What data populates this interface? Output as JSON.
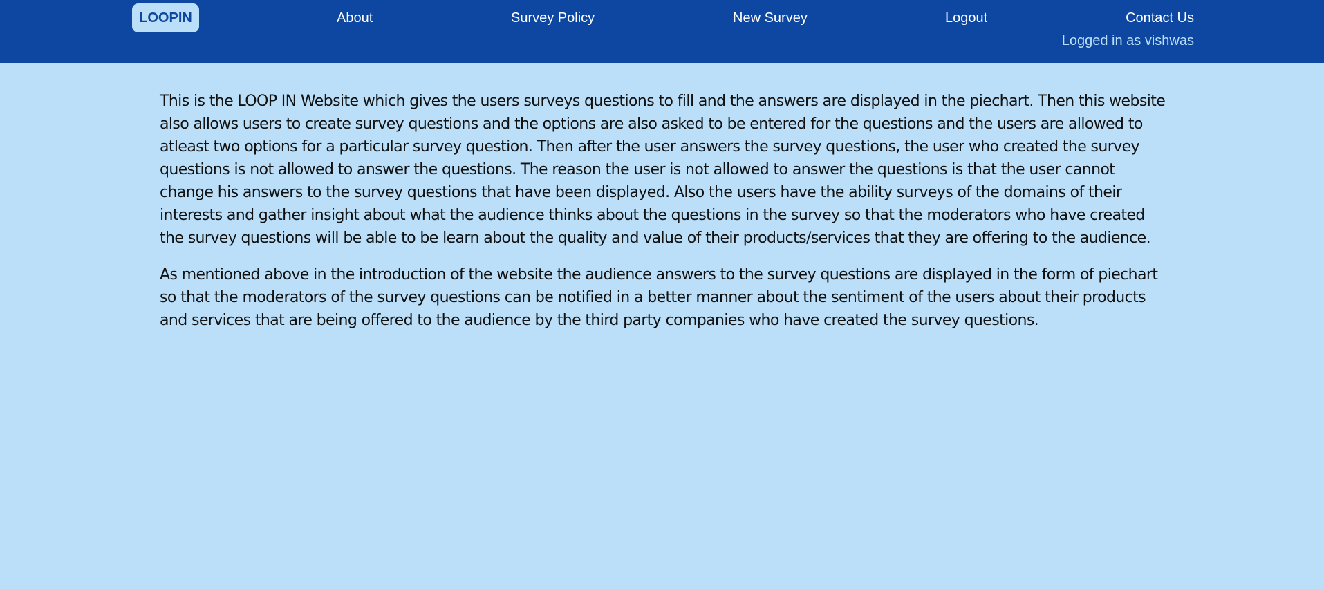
{
  "navbar": {
    "brand": "LOOPIN",
    "links": [
      {
        "label": "About"
      },
      {
        "label": "Survey Policy"
      },
      {
        "label": "New Survey"
      },
      {
        "label": "Logout"
      },
      {
        "label": "Contact Us"
      }
    ],
    "status": "Logged in as vishwas"
  },
  "main": {
    "paragraphs": [
      "This is the LOOP IN Website which gives the users surveys questions to fill and the answers are displayed in the piechart. Then this website also allows users to create survey questions and the options are also asked to be entered for the questions and the users are allowed to atleast two options for a particular survey question. Then after the user answers the survey questions, the user who created the survey questions is not allowed to answer the questions. The reason the user is not allowed to answer the questions is that the user cannot change his answers to the survey questions that have been displayed. Also the users have the ability surveys of the domains of their interests and gather insight about what the audience thinks about the questions in the survey so that the moderators who have created the survey questions will be able to be learn about the quality and value of their products/services that they are offering to the audience.",
      "As mentioned above in the introduction of the website the audience answers to the survey questions are displayed in the form of piechart so that the moderators of the survey questions can be notified in a better manner about the sentiment of the users about their products and services that are being offered to the audience by the third party companies who have created the survey questions."
    ]
  },
  "colors": {
    "navbar": "#0d47a1",
    "page_background": "#bbdff8",
    "brand_text": "#0d47a1",
    "nav_text": "#ffffff"
  }
}
